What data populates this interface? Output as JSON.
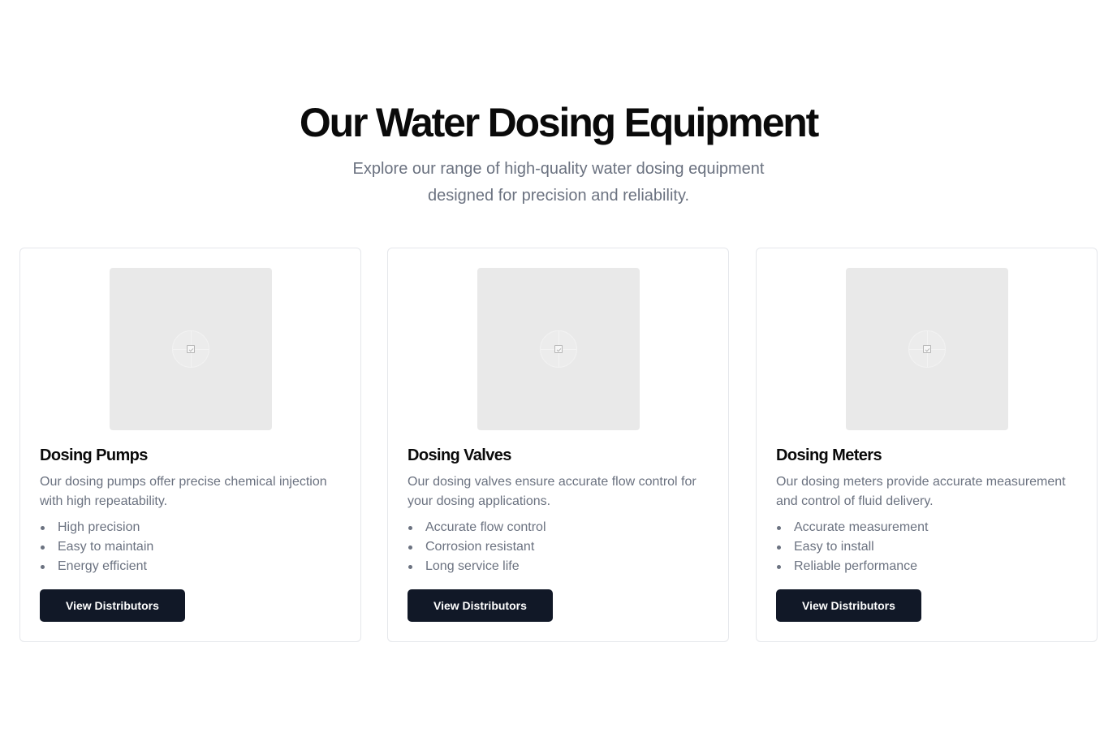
{
  "header": {
    "title": "Our Water Dosing Equipment",
    "subtitle": "Explore our range of high-quality water dosing equipment designed for precision and reliability."
  },
  "products": [
    {
      "title": "Dosing Pumps",
      "description": "Our dosing pumps offer precise chemical injection with high repeatability.",
      "features": [
        "High precision",
        "Easy to maintain",
        "Energy efficient"
      ],
      "button_label": "View Distributors",
      "image_icon": "image-placeholder-icon"
    },
    {
      "title": "Dosing Valves",
      "description": "Our dosing valves ensure accurate flow control for your dosing applications.",
      "features": [
        "Accurate flow control",
        "Corrosion resistant",
        "Long service life"
      ],
      "button_label": "View Distributors",
      "image_icon": "image-placeholder-icon"
    },
    {
      "title": "Dosing Meters",
      "description": "Our dosing meters provide accurate measurement and control of fluid delivery.",
      "features": [
        "Accurate measurement",
        "Easy to install",
        "Reliable performance"
      ],
      "button_label": "View Distributors",
      "image_icon": "image-placeholder-icon"
    }
  ],
  "colors": {
    "button_background": "#111827",
    "muted_text": "#6b7280",
    "card_border": "#e5e7eb",
    "image_placeholder": "#e9e9e9"
  }
}
